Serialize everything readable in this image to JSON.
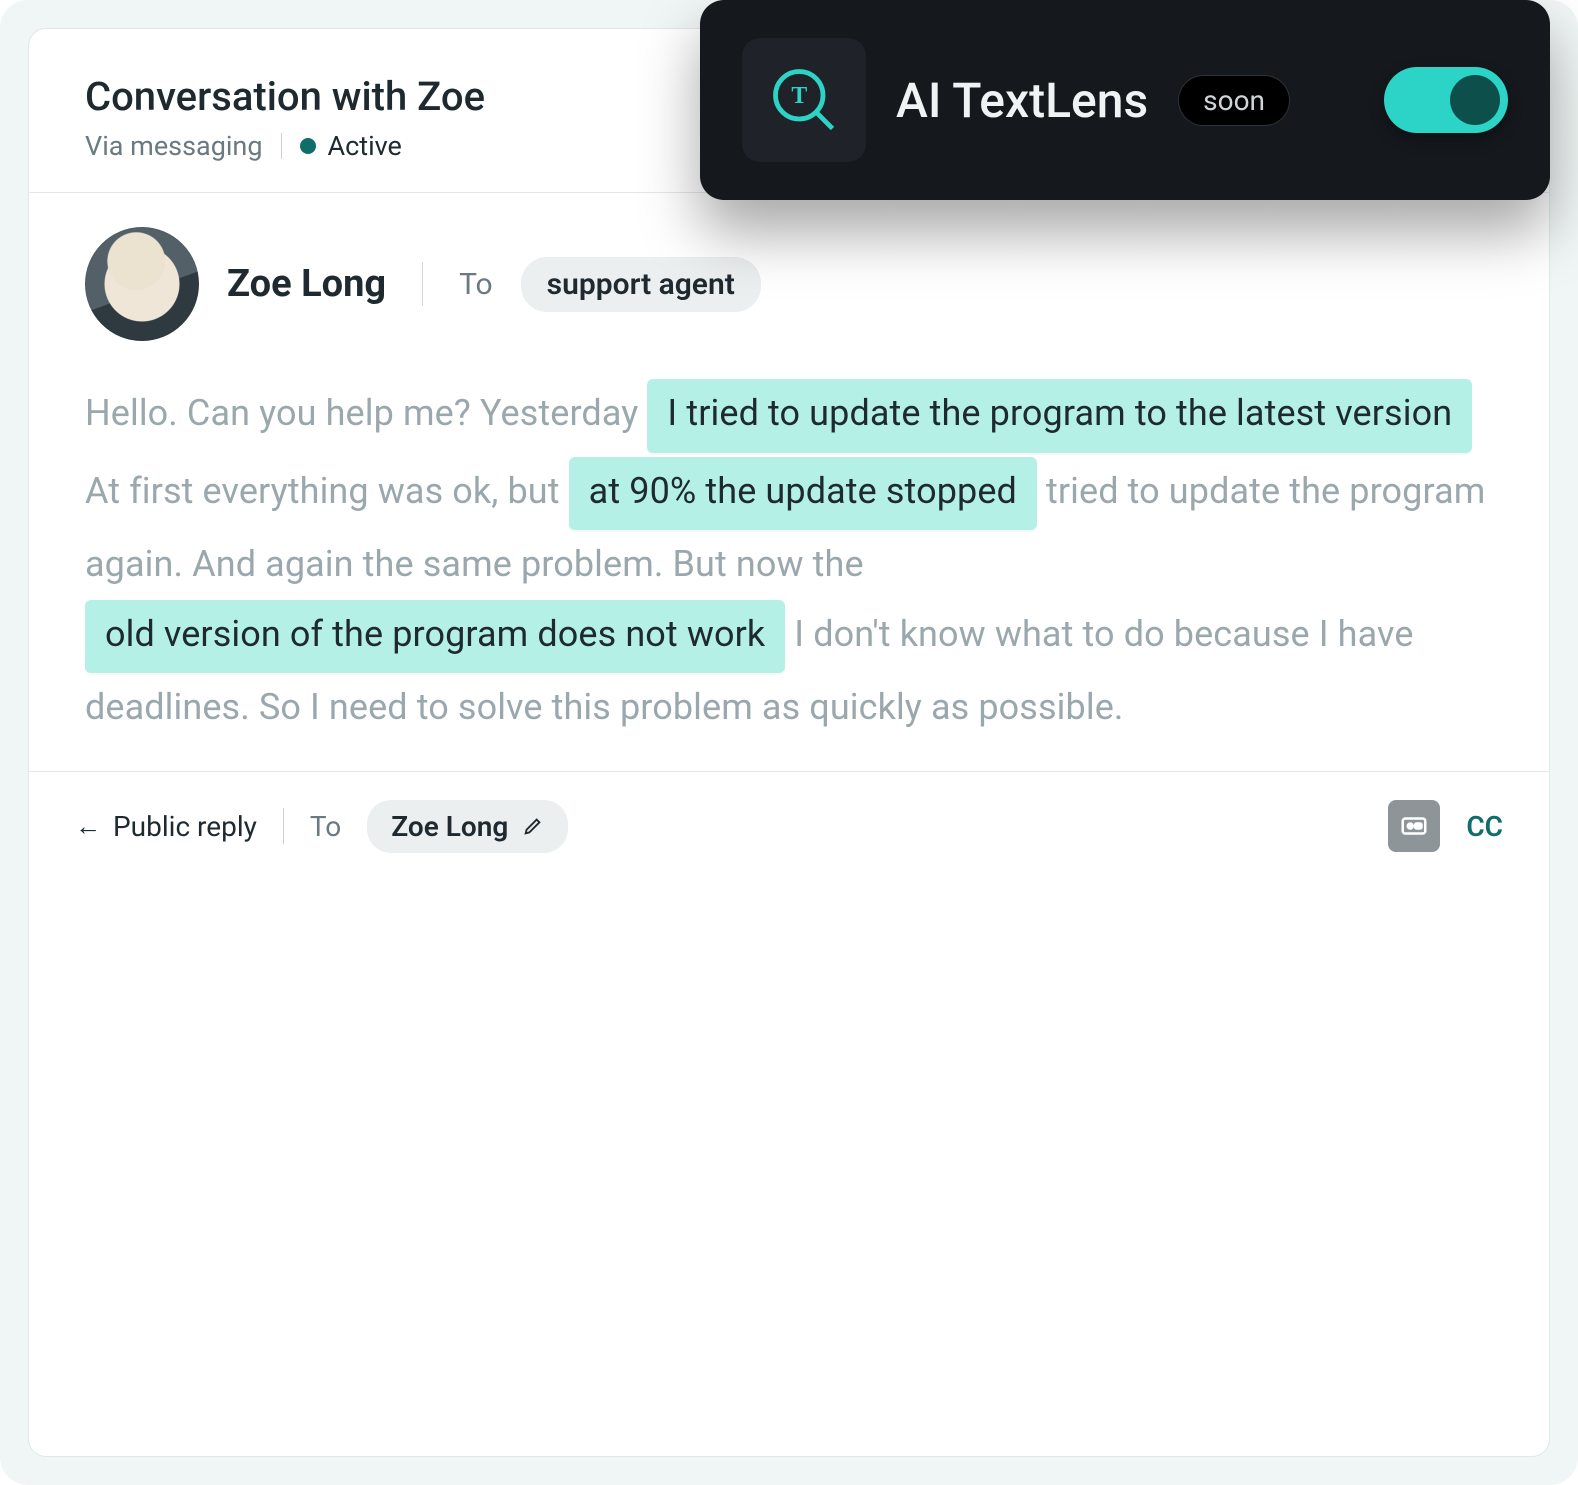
{
  "ai_panel": {
    "title": "AI TextLens",
    "badge": "soon",
    "toggle_on": true
  },
  "header": {
    "title": "Conversation with Zoe",
    "via": "Via messaging",
    "status": "Active"
  },
  "message": {
    "author": "Zoe Long",
    "to_label": "To",
    "to_value": "support agent",
    "parts": [
      {
        "t": "plain",
        "text": "Hello. Can you help me? Yesterday "
      },
      {
        "t": "hl",
        "text": "I tried to update the program to the latest version"
      },
      {
        "t": "plain",
        "text": " At first everything was ok, but "
      },
      {
        "t": "hl",
        "text": "at 90% the update stopped"
      },
      {
        "t": "plain",
        "text": " tried to update the program again. And again the same problem. But now the "
      },
      {
        "t": "hl",
        "text": "old version of the program does not work"
      },
      {
        "t": "plain",
        "text": " I don't know what to do because I have deadlines. So I need to solve this problem as quickly as possible."
      }
    ]
  },
  "reply": {
    "mode": "Public reply",
    "to_label": "To",
    "to_value": "Zoe Long",
    "cc": "CC"
  }
}
